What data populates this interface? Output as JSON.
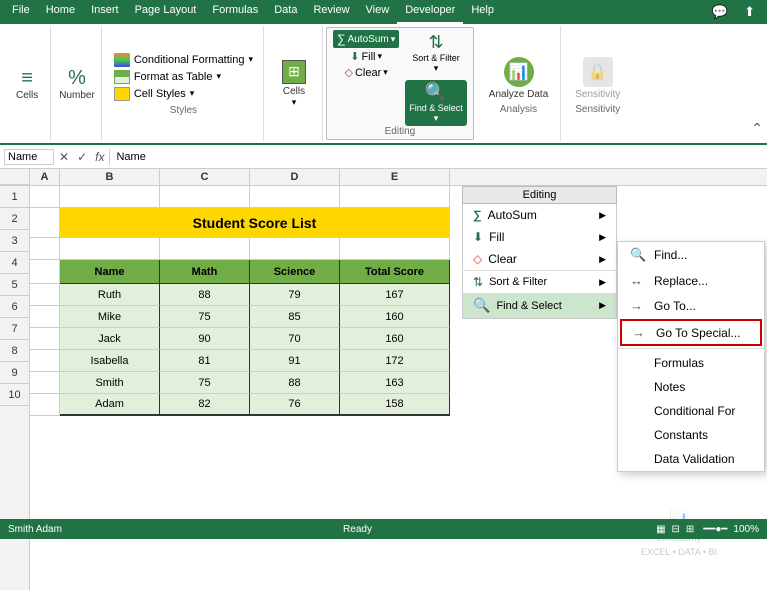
{
  "ribbon": {
    "tabs": [
      "File",
      "Home",
      "Insert",
      "Page Layout",
      "Formulas",
      "Data",
      "Review",
      "View",
      "Developer",
      "Help"
    ],
    "active_tab": "Developer",
    "groups": {
      "styles": {
        "label": "Styles",
        "conditional_formatting": "Conditional Formatting",
        "format_as_table": "Format as Table",
        "cell_styles": "Cell Styles"
      },
      "cells": {
        "label": "Cells",
        "btn": "Cells"
      },
      "editing": {
        "label": "Editing",
        "btn": "Editing",
        "autosum": "AutoSum",
        "fill": "Fill",
        "clear": "Clear",
        "sort_filter": "Sort & Filter",
        "find_select": "Find & Select"
      },
      "analysis": {
        "label": "Analysis",
        "analyze_data": "Analyze Data"
      },
      "sensitivity": {
        "label": "Sensitivity",
        "sensitivity": "Sensitivity"
      }
    }
  },
  "formula_bar": {
    "cell_ref": "Name",
    "formula": "Name",
    "cancel": "✕",
    "confirm": "✓",
    "function": "fx"
  },
  "columns": {
    "letters": [
      "B",
      "C",
      "D",
      "E"
    ],
    "widths": [
      100,
      90,
      90,
      110
    ]
  },
  "rows": {
    "numbers": [
      "1",
      "2",
      "3",
      "4",
      "5",
      "6",
      "7",
      "8",
      "9",
      "10"
    ]
  },
  "spreadsheet": {
    "title": "Student Score List",
    "headers": [
      "Name",
      "Math",
      "Science",
      "Total Score"
    ],
    "data": [
      {
        "name": "Ruth",
        "math": 88,
        "science": 79,
        "total": 167
      },
      {
        "name": "Mike",
        "math": 75,
        "science": 85,
        "total": 160
      },
      {
        "name": "Jack",
        "math": 90,
        "science": 70,
        "total": 160
      },
      {
        "name": "Isabella",
        "math": 81,
        "science": 91,
        "total": 172
      },
      {
        "name": "Smith",
        "math": 75,
        "science": 88,
        "total": 163
      },
      {
        "name": "Adam",
        "math": 82,
        "science": 76,
        "total": 158
      }
    ]
  },
  "dropdown": {
    "title": "Editing",
    "items": [
      {
        "icon": "∑",
        "label": "AutoSum",
        "has_arrow": true
      },
      {
        "icon": "⬇",
        "label": "Fill",
        "has_arrow": true
      },
      {
        "icon": "◇",
        "label": "Clear",
        "has_arrow": true
      },
      {
        "icon": "⇅",
        "label": "Sort & Filter",
        "has_arrow": true
      },
      {
        "icon": "🔍",
        "label": "Find & Select",
        "has_arrow": true
      }
    ]
  },
  "subdropdown": {
    "items": [
      {
        "label": "Find...",
        "icon": "🔍"
      },
      {
        "label": "Replace...",
        "icon": "🔄"
      },
      {
        "label": "Go To...",
        "icon": "→"
      },
      {
        "label": "Go To Special...",
        "icon": "→",
        "highlighted": true
      },
      {
        "label": "Formulas",
        "icon": ""
      },
      {
        "label": "Notes",
        "icon": ""
      },
      {
        "label": "Conditional For",
        "icon": ""
      },
      {
        "label": "Constants",
        "icon": ""
      },
      {
        "label": "Data Validation",
        "icon": ""
      }
    ]
  },
  "status_bar": {
    "left": "Smith  Adam",
    "mode": "Ready"
  },
  "watermark": "exceltomy\nEXCEL - DATA - BI"
}
